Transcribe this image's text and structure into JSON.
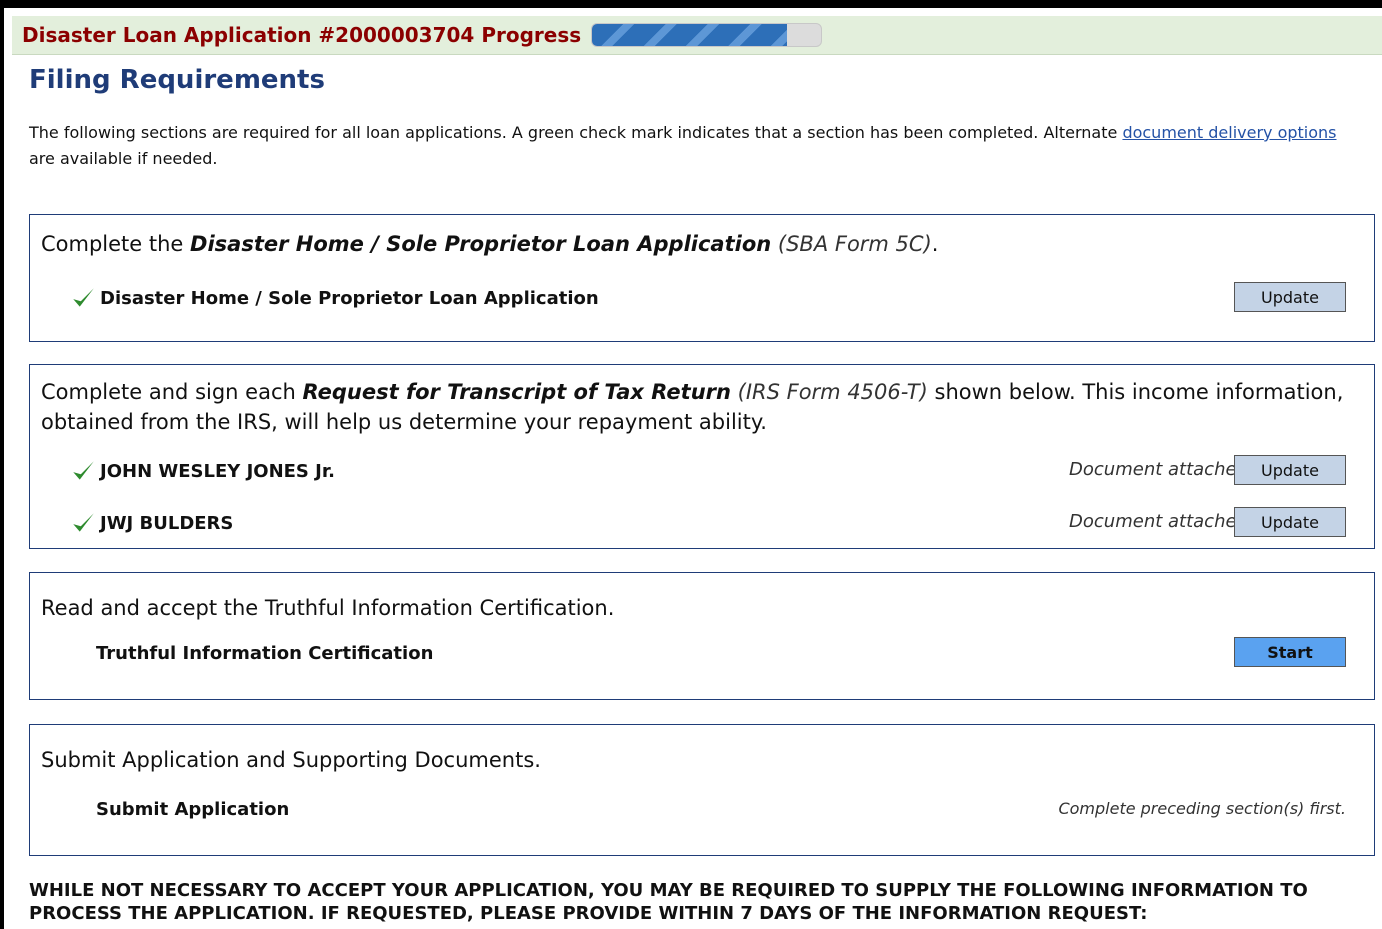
{
  "header": {
    "title": "Disaster Loan Application #2000003704",
    "progress_label": "Progress",
    "progress_fraction": 0.85
  },
  "page": {
    "heading": "Filing Requirements",
    "intro_text": "The following sections are required for all loan applications. A green check mark indicates that a section has been completed. Alternate",
    "intro_link": "document delivery options",
    "intro_tail": "are available if needed."
  },
  "sections": [
    {
      "lead_pre": "Complete the",
      "lead_bold": "Disaster Home / Sole Proprietor Loan Application",
      "lead_form": "(SBA Form 5C)",
      "lead_post": ".",
      "items": [
        {
          "label": "Disaster Home / Sole Proprietor Loan Application",
          "button": "Update",
          "icon": "check-icon"
        }
      ]
    },
    {
      "lead_pre": "Complete and sign each",
      "lead_bold": "Request for Transcript of Tax Return",
      "lead_form": "(IRS Form 4506-T)",
      "lead_post": "shown below. This income information, obtained from the IRS, will help us determine your repayment ability.",
      "items": [
        {
          "label": "JOHN WESLEY JONES Jr.",
          "status": "Document attached",
          "button": "Update",
          "icon": "check-icon"
        },
        {
          "label": "JWJ BULDERS",
          "status": "Document attached",
          "button": "Update",
          "icon": "check-icon"
        }
      ]
    },
    {
      "lead": "Read and accept the Truthful Information Certification.",
      "items": [
        {
          "label": "Truthful Information Certification",
          "button": "Start"
        }
      ]
    },
    {
      "lead": "Submit Application and Supporting Documents.",
      "items": [
        {
          "label": "Submit Application",
          "note": "Complete preceding section(s) first."
        }
      ]
    }
  ],
  "footer_text": "WHILE NOT NECESSARY TO ACCEPT YOUR APPLICATION, YOU MAY BE REQUIRED TO SUPPLY THE FOLLOWING INFORMATION TO PROCESS THE APPLICATION. IF REQUESTED, PLEASE PROVIDE WITHIN 7 DAYS OF THE INFORMATION REQUEST:",
  "colors": {
    "title": "#8b0000",
    "heading": "#1f3c78",
    "check": "#2e8b2e",
    "start_button": "#5aa2f0",
    "update_button": "#c4d3e6"
  }
}
